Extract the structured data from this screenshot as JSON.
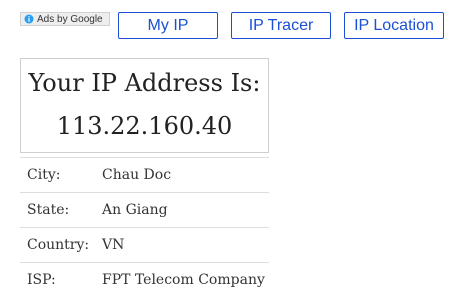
{
  "ads": {
    "label": "Ads by Google",
    "icon": "info-icon",
    "icon_color": "#2a9df4"
  },
  "nav": {
    "my_ip": "My IP",
    "ip_tracer": "IP Tracer",
    "ip_location": "IP Location"
  },
  "ip_box": {
    "title": "Your IP Address Is:",
    "address": "113.22.160.40"
  },
  "details": [
    {
      "label": "City:",
      "value": "Chau Doc"
    },
    {
      "label": "State:",
      "value": "An Giang"
    },
    {
      "label": "Country:",
      "value": "VN"
    },
    {
      "label": "ISP:",
      "value": "FPT Telecom Company"
    }
  ],
  "colors": {
    "accent": "#1a4fd6",
    "border": "#cfcfcf"
  }
}
